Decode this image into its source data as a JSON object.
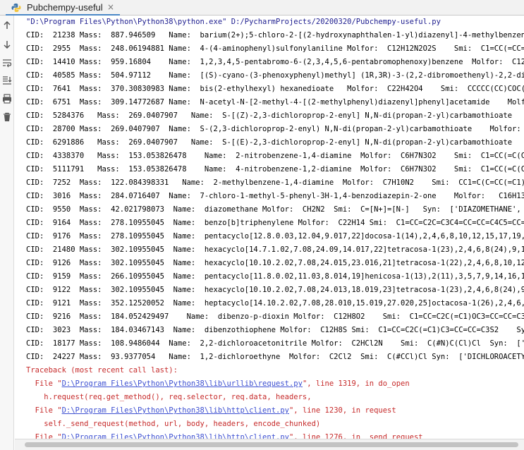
{
  "header": {
    "tab_title": "Pubchempy-useful",
    "close_glyph": "×",
    "accent": "#4a88c7"
  },
  "toolbar": {
    "buttons": [
      {
        "name": "up-arrow-icon"
      },
      {
        "name": "down-arrow-icon"
      },
      {
        "name": "soft-wrap-icon"
      },
      {
        "name": "scroll-to-end-icon"
      },
      {
        "name": "print-icon"
      },
      {
        "name": "trash-icon"
      }
    ]
  },
  "console": {
    "command": "\"D:\\Program Files\\Python\\Python38\\python.exe\" D:/PycharmProjects/20200320/Pubchempy-useful.py",
    "rows": [
      "CID:  21238 Mass:  887.946509   Name:  barium(2+);5-chloro-2-[(2-hydroxynaphthalen-1-yl)diazenyl]-4-methylbenzenesulfonate",
      "CID:  2955  Mass:  248.06194881 Name:  4-(4-aminophenyl)sulfonylaniline Molfor:  C12H12N2O2S    Smi:  C1=CC(=CC=C1N)S",
      "CID:  14410 Mass:  959.16804    Name:  1,2,3,4,5-pentabromo-6-(2,3,4,5,6-pentabromophenoxy)benzene  Molfor:  C12Br10O",
      "CID:  40585 Mass:  504.97112    Name:  [(S)-cyano-(3-phenoxyphenyl)methyl] (1R,3R)-3-(2,2-dibromoethenyl)-2,2-dimethyl",
      "CID:  7641  Mass:  370.30830983 Name:  bis(2-ethylhexyl) hexanedioate   Molfor:  C22H42O4    Smi:  CCCCC(CC)COC(=O)CCCC",
      "CID:  6751  Mass:  309.14772687 Name:  N-acetyl-N-[2-methyl-4-[(2-methylphenyl)diazenyl]phenyl]acetamide    Molfor:  C",
      "CID:  5284376   Mass:  269.0407907   Name:  S-[(Z)-2,3-dichloroprop-2-enyl] N,N-di(propan-2-yl)carbamothioate    Molfor",
      "CID:  28700 Mass:  269.0407907  Name:  S-(2,3-dichloroprop-2-enyl) N,N-di(propan-2-yl)carbamothioate    Molfor:  C10H1",
      "CID:  6291886   Mass:  269.0407907   Name:  S-[(E)-2,3-dichloroprop-2-enyl] N,N-di(propan-2-yl)carbamothioate    Molfor",
      "CID:  4338370   Mass:  153.053826478    Name:  2-nitrobenzene-1,4-diamine  Molfor:  C6H7N3O2    Smi:  C1=CC(=C(C=C1N)[",
      "CID:  5111791   Mass:  153.053826478    Name:  4-nitrobenzene-1,2-diamine  Molfor:  C6H7N3O2    Smi:  C1=CC(=C(C=C1[N+",
      "CID:  7252  Mass:  122.084398331   Name:  2-methylbenzene-1,4-diamine  Molfor:  C7H10N2    Smi:  CC1=C(C=CC(=C1)N)N",
      "CID:  3016  Mass:  284.0716407  Name:  7-chloro-1-methyl-5-phenyl-3H-1,4-benzodiazepin-2-one    Molfor:   C16H13ClN2O",
      "CID:  9550  Mass:  42.021798073  Name:  diazomethane Molfor:  CH2N2  Smi:  C=[N+]=[N-]   Syn:  ['DIAZOMETHANE', 'Azimet",
      "CID:  9164  Mass:  278.10955045  Name:  benzo[b]triphenylene Molfor:  C22H14 Smi:  C1=CC=C2C=C3C4=CC=CC=C4C5=CC=CC=C5C3",
      "CID:  9176  Mass:  278.10955045  Name:  pentacyclo[12.8.0.03,12.04,9.017,22]docosa-1(14),2,4,6,8,10,12,15,17,19,21-unde",
      "CID:  21480 Mass:  302.10955045  Name:  hexacyclo[14.7.1.02,7.08,24.09,14.017,22]tetracosa-1(23),2,4,6,8(24),9,11,13,15",
      "CID:  9126  Mass:  302.10955045  Name:  hexacyclo[10.10.2.02,7.08,24.015,23.016,21]tetracosa-1(22),2,4,6,8,10,12(24),13",
      "CID:  9159  Mass:  266.10955045  Name:  pentacyclo[11.8.0.02,11.03,8.014,19]henicosa-1(13),2(11),3,5,7,9,14,16,18,20-de",
      "CID:  9122  Mass:  302.10955045  Name:  hexacyclo[10.10.2.02,7.08,24.013,18.019,23]tetracosa-1(23),2,4,6,8(24),9,11,13,15",
      "CID:  9121  Mass:  352.12520052  Name:  heptacyclo[14.10.2.02,7.08,28.010,15.019,27.020,25]octacosa-1(26),2,4,6,8,10,12",
      "CID:  9216  Mass:  184.052429497    Name:  dibenzo-p-dioxin Molfor:  C12H8O2    Smi:  C1=CC=C2C(=C1)OC3=CC=CC=C3O2   Syn",
      "CID:  3023  Mass:  184.03467143  Name:  dibenzothiophene Molfor:  C12H8S Smi:  C1=CC=C2C(=C1)C3=CC=CC=C3S2    Syn:  ['di",
      "CID:  18177 Mass:  108.9486044  Name:  2,2-dichloroacetonitrile Molfor:  C2HCl2N    Smi:  C(#N)C(Cl)Cl  Syn:  ['DICHLO",
      "CID:  24227 Mass:  93.9377054   Name:  1,2-dichloroethyne  Molfor:  C2Cl2  Smi:  C(#CCl)Cl Syn:  ['DICHLOROACETYLENE'"
    ],
    "traceback_header": "Traceback (most recent call last):",
    "traceback": [
      {
        "type": "file",
        "prefix": "  File \"",
        "path": "D:\\Program Files\\Python\\Python38\\lib\\urllib\\request.py",
        "suffix": "\", line 1319, in do_open"
      },
      {
        "type": "code",
        "text": "    h.request(req.get_method(), req.selector, req.data, headers,"
      },
      {
        "type": "file",
        "prefix": "  File \"",
        "path": "D:\\Program Files\\Python\\Python38\\lib\\http\\client.py",
        "suffix": "\", line 1230, in request"
      },
      {
        "type": "code",
        "text": "    self._send_request(method, url, body, headers, encode_chunked)"
      },
      {
        "type": "file",
        "prefix": "  File \"",
        "path": "D:\\Program Files\\Python\\Python38\\lib\\http\\client.py",
        "suffix": "\", line 1276, in _send_request"
      }
    ]
  }
}
